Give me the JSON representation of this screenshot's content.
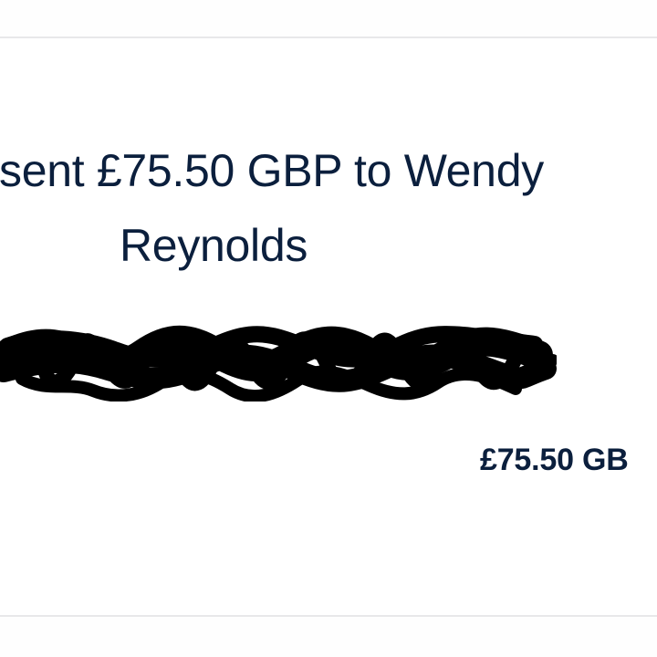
{
  "transaction": {
    "headline_line_1": "sent £75.50 GBP to Wendy",
    "headline_line_2": "Reynolds",
    "amount": "£75.50 GB"
  },
  "colors": {
    "text": "#0b1f3d",
    "border": "#e8e8ea",
    "background": "#ffffff"
  }
}
